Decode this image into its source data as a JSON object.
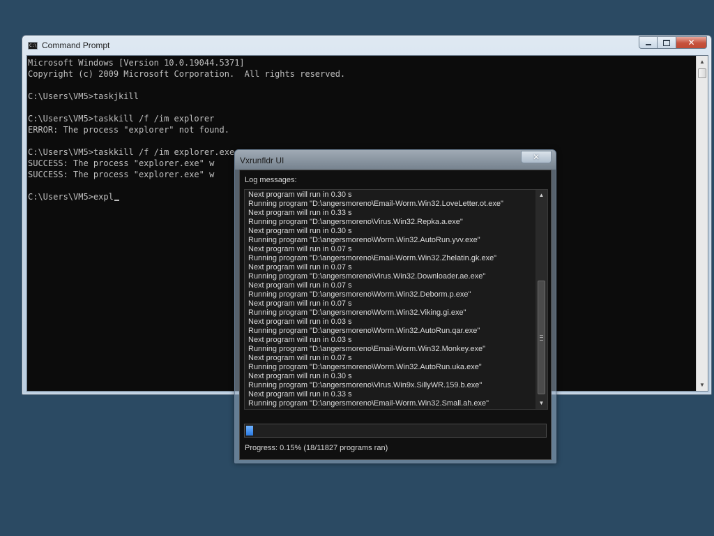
{
  "colors": {
    "desktop": "#2b4a63",
    "console_bg": "#0c0c0c",
    "console_text": "#c0c0c0",
    "progress_fill": "#2a7ae2"
  },
  "cmd": {
    "title": "Command Prompt",
    "icon": "console-icon",
    "lines": [
      "Microsoft Windows [Version 10.0.19044.5371]",
      "Copyright (c) 2009 Microsoft Corporation.  All rights reserved.",
      "",
      "C:\\Users\\VM5>taskjkill",
      "",
      "C:\\Users\\VM5>taskkill /f /im explorer",
      "ERROR: The process \"explorer\" not found.",
      "",
      "C:\\Users\\VM5>taskkill /f /im explorer.exe",
      "SUCCESS: The process \"explorer.exe\" w",
      "SUCCESS: The process \"explorer.exe\" w",
      ""
    ],
    "prompt_line": "C:\\Users\\VM5>expl"
  },
  "vx": {
    "title": "Vxrunfldr UI",
    "close_label": "✕",
    "log_label": "Log messages:",
    "log_lines": [
      "Next program will run in 0.30 s",
      "Running program \"D:\\angersmoreno\\Email-Worm.Win32.LoveLetter.ot.exe\"",
      "Next program will run in 0.33 s",
      "Running program \"D:\\angersmoreno\\Virus.Win32.Repka.a.exe\"",
      "Next program will run in 0.30 s",
      "Running program \"D:\\angersmoreno\\Worm.Win32.AutoRun.yvv.exe\"",
      "Next program will run in 0.07 s",
      "Running program \"D:\\angersmoreno\\Email-Worm.Win32.Zhelatin.gk.exe\"",
      "Next program will run in 0.07 s",
      "Running program \"D:\\angersmoreno\\Virus.Win32.Downloader.ae.exe\"",
      "Next program will run in 0.07 s",
      "Running program \"D:\\angersmoreno\\Worm.Win32.Deborm.p.exe\"",
      "Next program will run in 0.07 s",
      "Running program \"D:\\angersmoreno\\Worm.Win32.Viking.gi.exe\"",
      "Next program will run in 0.03 s",
      "Running program \"D:\\angersmoreno\\Worm.Win32.AutoRun.qar.exe\"",
      "Next program will run in 0.03 s",
      "Running program \"D:\\angersmoreno\\Email-Worm.Win32.Monkey.exe\"",
      "Next program will run in 0.07 s",
      "Running program \"D:\\angersmoreno\\Worm.Win32.AutoRun.uka.exe\"",
      "Next program will run in 0.30 s",
      "Running program \"D:\\angersmoreno\\Virus.Win9x.SillyWR.159.b.exe\"",
      "Next program will run in 0.33 s",
      "Running program \"D:\\angersmoreno\\Email-Worm.Win32.Small.ah.exe\""
    ],
    "progress_fraction": 0.0015,
    "progress_text": "Progress: 0.15% (18/11827 programs ran)"
  }
}
